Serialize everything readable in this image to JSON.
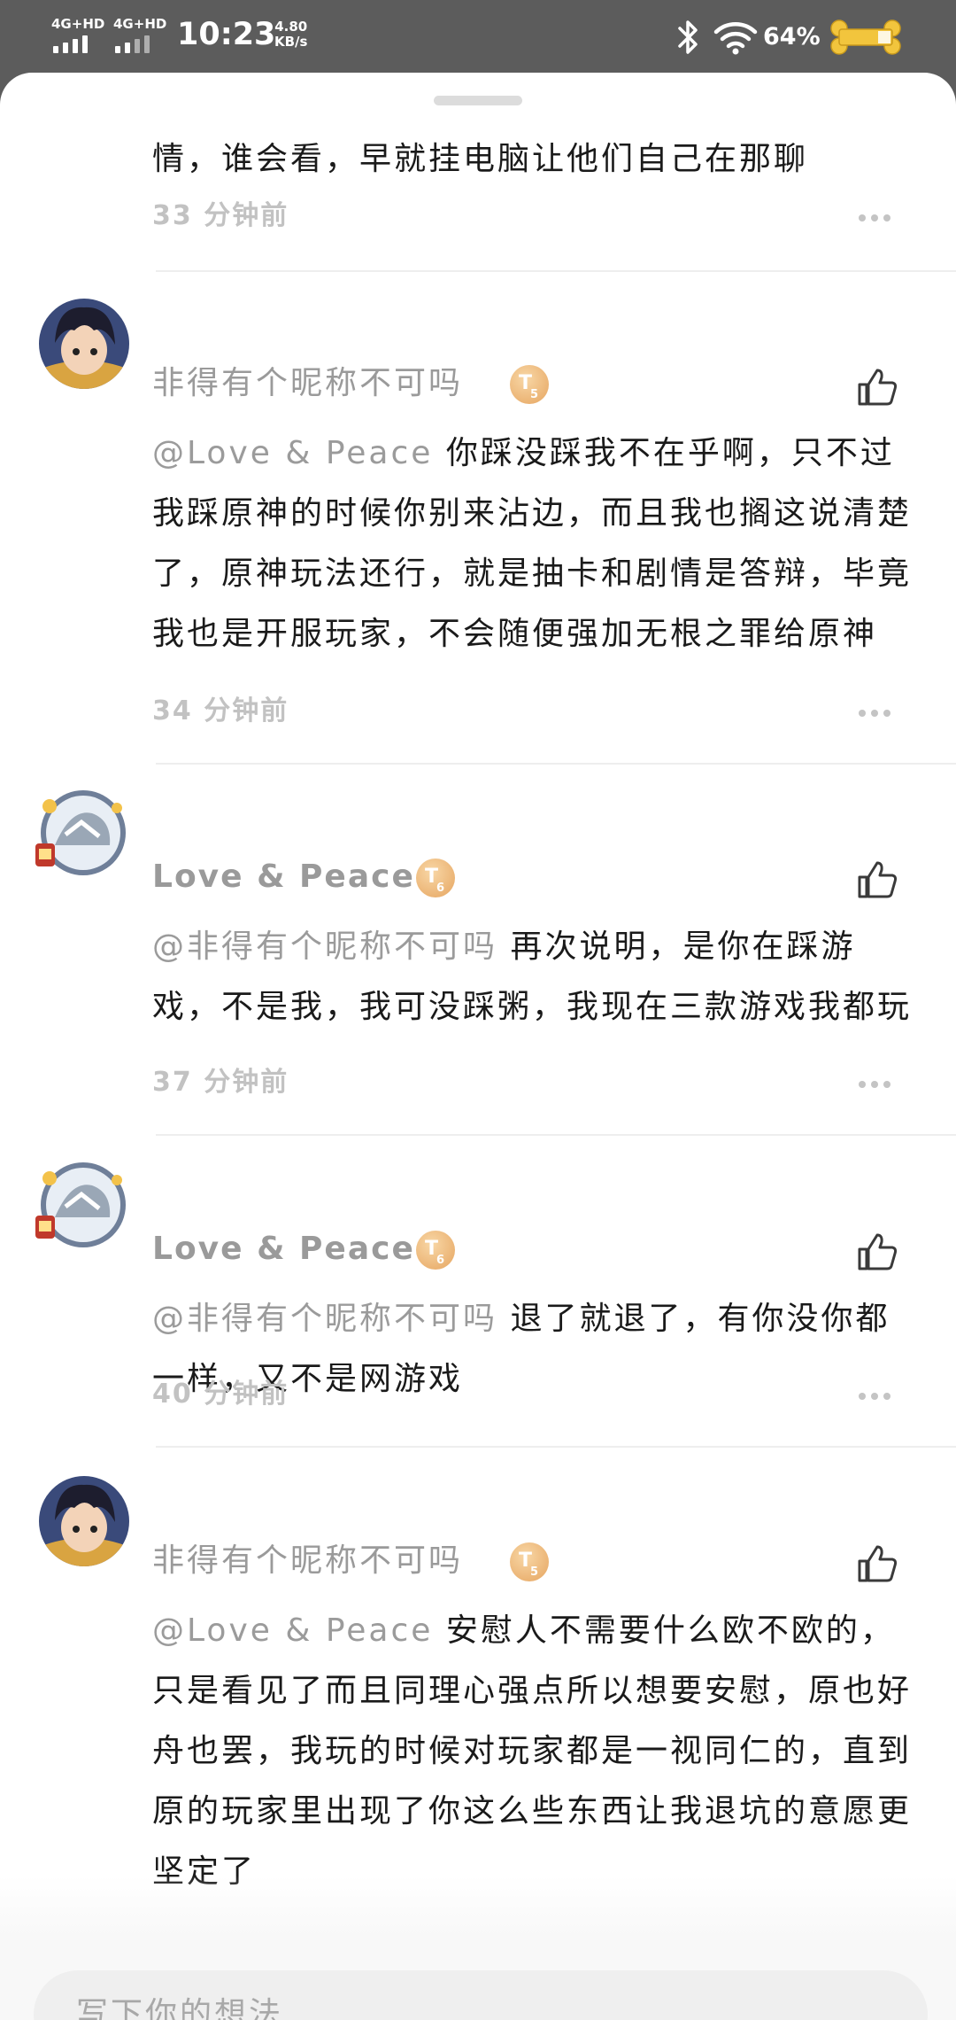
{
  "status_bar": {
    "signal1_label": "4G+HD",
    "signal2_label": "4G+HD",
    "time": "10:23",
    "net_speed_value": "4.80",
    "net_speed_unit": "KB/s",
    "battery_text": "64%",
    "icons": [
      "bluetooth-icon",
      "wifi-icon",
      "battery-bone-icon"
    ]
  },
  "comments": [
    {
      "text": "情，谁会看，早就挂电脑让他们自己在那聊",
      "time": "33 分钟前"
    },
    {
      "author": "非得有个昵称不可吗",
      "level_letter": "T",
      "level_num": "5",
      "mention": "@Love & Peace",
      "text": "你踩没踩我不在乎啊，只不过我踩原神的时候你别来沾边，而且我也搁这说清楚了，原神玩法还行，就是抽卡和剧情是答辩，毕竟我也是开服玩家，不会随便强加无根之罪给原神",
      "time": "34 分钟前"
    },
    {
      "author": "Love & Peace",
      "level_letter": "T",
      "level_num": "6",
      "mention": "@非得有个昵称不可吗",
      "text": "再次说明，是你在踩游戏，不是我，我可没踩粥，我现在三款游戏我都玩",
      "time": "37 分钟前"
    },
    {
      "author": "Love & Peace",
      "level_letter": "T",
      "level_num": "6",
      "mention": "@非得有个昵称不可吗",
      "text": "退了就退了，有你没你都一样，又不是网游戏",
      "time": "40 分钟前"
    },
    {
      "author": "非得有个昵称不可吗",
      "level_letter": "T",
      "level_num": "5",
      "mention": "@Love & Peace",
      "text": "安慰人不需要什么欧不欧的，只是看见了而且同理心强点所以想要安慰，原也好舟也罢，我玩的时候对玩家都是一视同仁的，直到原的玩家里出现了你这么些东西让我退坑的意愿更坚定了"
    }
  ],
  "input": {
    "placeholder": "写下你的想法..."
  },
  "colors": {
    "status_bar_bg": "#5c5c5c",
    "mention": "#9b9b9b",
    "level_badge": "#e6a560"
  }
}
